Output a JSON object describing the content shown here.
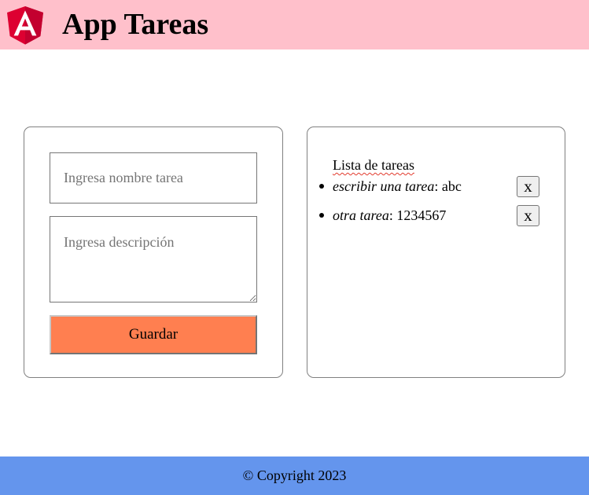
{
  "header": {
    "title": "App Tareas",
    "logo_icon": "angular-logo-icon",
    "background": "#ffc0cb"
  },
  "form": {
    "name_placeholder": "Ingresa nombre tarea",
    "name_value": "",
    "description_placeholder": "Ingresa descripción",
    "description_value": "",
    "save_label": "Guardar",
    "save_color": "#ff7f50"
  },
  "list": {
    "title": "Lista de tareas",
    "delete_label": "x",
    "items": [
      {
        "name": "escribir una tarea",
        "separator": ": ",
        "description": "abc"
      },
      {
        "name": "otra tarea",
        "separator": ": ",
        "description": "1234567"
      }
    ]
  },
  "footer": {
    "text": "© Copyright 2023",
    "background": "#6495ed"
  }
}
